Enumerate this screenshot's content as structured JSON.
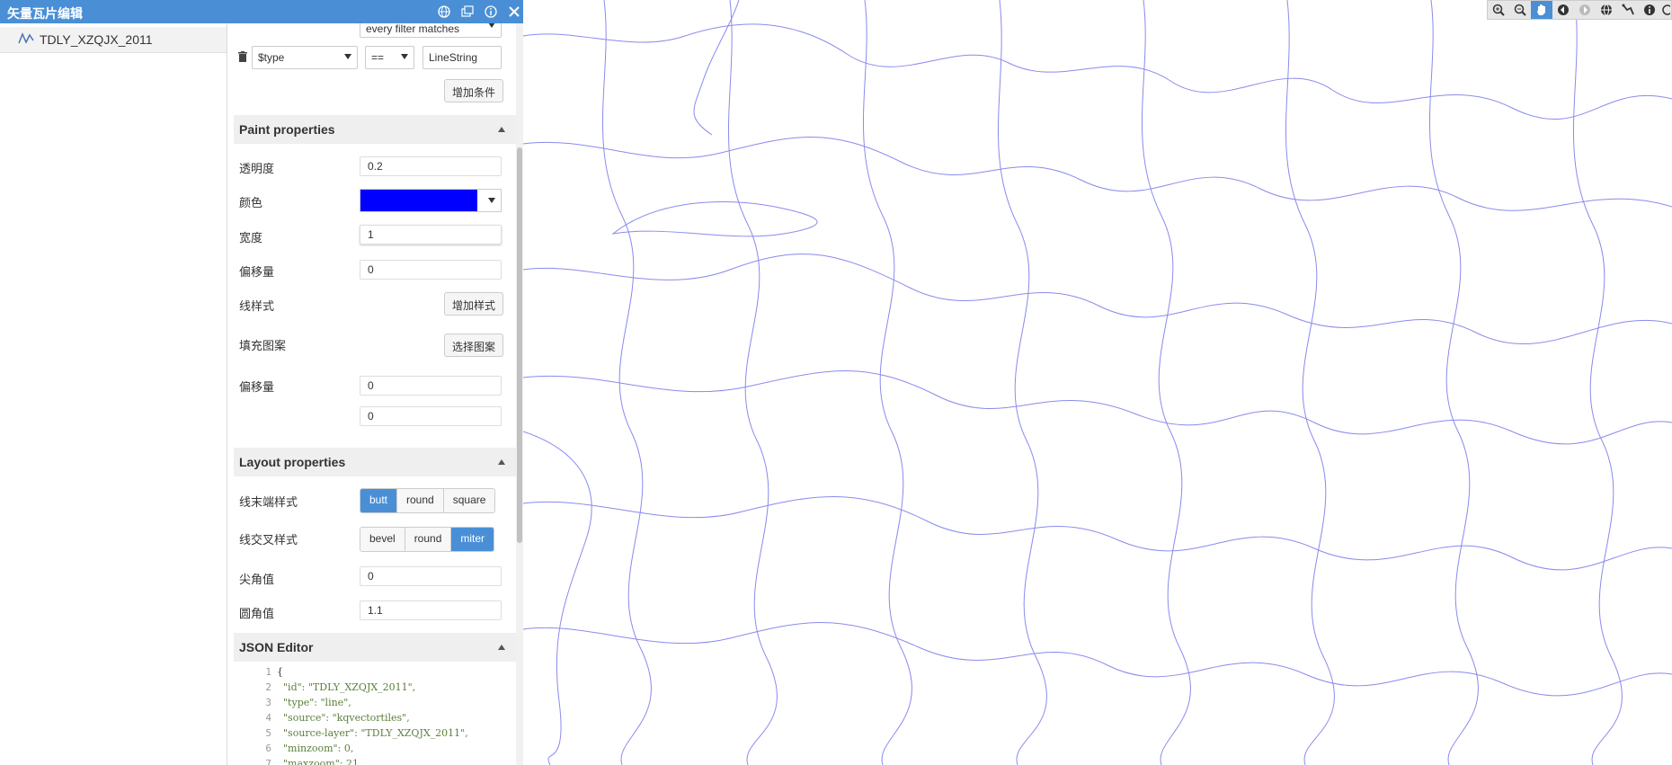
{
  "window": {
    "title": "矢量瓦片编辑"
  },
  "layer_list": [
    {
      "label": "TDLY_XZQJX_2011"
    }
  ],
  "filter": {
    "mode_value": "every filter matches",
    "field_value": "$type",
    "operator_value": "==",
    "value_text": "LineString",
    "add_condition_label": "增加条件"
  },
  "paint": {
    "header": "Paint properties",
    "opacity_label": "透明度",
    "opacity_value": "0.2",
    "color_label": "颜色",
    "color_value": "#0000ff",
    "width_label": "宽度",
    "width_value": "1",
    "offset_label": "偏移量",
    "offset_value": "0",
    "dash_label": "线样式",
    "dash_button": "增加样式",
    "pattern_label": "填充图案",
    "pattern_button": "选择图案",
    "translate_label": "偏移量",
    "translate_x": "0",
    "translate_y": "0"
  },
  "layout": {
    "header": "Layout properties",
    "cap_label": "线末端样式",
    "cap_options": [
      "butt",
      "round",
      "square"
    ],
    "cap_selected": "butt",
    "join_label": "线交叉样式",
    "join_options": [
      "bevel",
      "round",
      "miter"
    ],
    "join_selected": "miter",
    "miter_label": "尖角值",
    "miter_value": "0",
    "round_label": "圆角值",
    "round_value": "1.1"
  },
  "json_editor": {
    "header": "JSON Editor",
    "lines": [
      {
        "n": "1",
        "text": "{"
      },
      {
        "n": "2",
        "text": "  \"id\": \"TDLY_XZQJX_2011\","
      },
      {
        "n": "3",
        "text": "  \"type\": \"line\","
      },
      {
        "n": "4",
        "text": "  \"source\": \"kqvectortiles\","
      },
      {
        "n": "5",
        "text": "  \"source-layer\": \"TDLY_XZQJX_2011\","
      },
      {
        "n": "6",
        "text": "  \"minzoom\": 0,"
      },
      {
        "n": "7",
        "text": "  \"maxzoom\": 21"
      }
    ]
  },
  "map": {
    "boundary_color": "#8a8aee"
  },
  "icons": {
    "titlebar": [
      "globe-icon",
      "windows-icon",
      "info-icon",
      "close-icon"
    ],
    "map_toolbar": [
      "zoom-in-icon",
      "zoom-out-icon",
      "pan-hand-icon",
      "back-icon",
      "forward-icon",
      "globe-icon",
      "measure-icon",
      "info-icon",
      "more-icon"
    ]
  }
}
